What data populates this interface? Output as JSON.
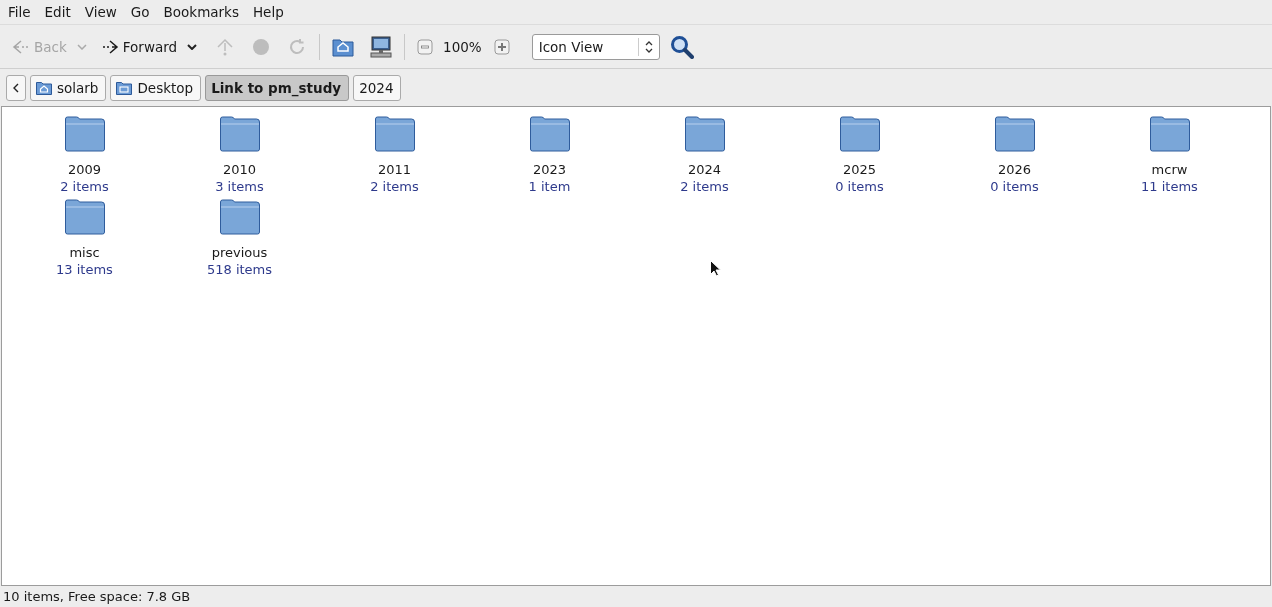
{
  "menu_bar": [
    "File",
    "Edit",
    "View",
    "Go",
    "Bookmarks",
    "Help"
  ],
  "toolbar": {
    "back": {
      "label": "Back",
      "disabled": true
    },
    "forward": {
      "label": "Forward",
      "disabled": false
    },
    "up": {
      "disabled": true
    },
    "stop": {
      "disabled": true
    },
    "reload": {
      "disabled": true
    },
    "zoom": "100%",
    "view_mode": "Icon View"
  },
  "path_bar": [
    {
      "label": "solarb",
      "kind": "home",
      "selected": false
    },
    {
      "label": "Desktop",
      "kind": "desktop",
      "selected": false
    },
    {
      "label": "Link to pm_study",
      "kind": "plain",
      "selected": true
    },
    {
      "label": "2024",
      "kind": "plain",
      "selected": false
    }
  ],
  "folders": [
    {
      "name": "2009",
      "count": "2 items"
    },
    {
      "name": "2010",
      "count": "3 items"
    },
    {
      "name": "2011",
      "count": "2 items"
    },
    {
      "name": "2023",
      "count": "1 item"
    },
    {
      "name": "2024",
      "count": "2 items"
    },
    {
      "name": "2025",
      "count": "0 items"
    },
    {
      "name": "2026",
      "count": "0 items"
    },
    {
      "name": "mcrw",
      "count": "11 items"
    },
    {
      "name": "misc",
      "count": "13 items"
    },
    {
      "name": "previous",
      "count": "518 items"
    }
  ],
  "status_bar": "10 items, Free space: 7.8 GB"
}
